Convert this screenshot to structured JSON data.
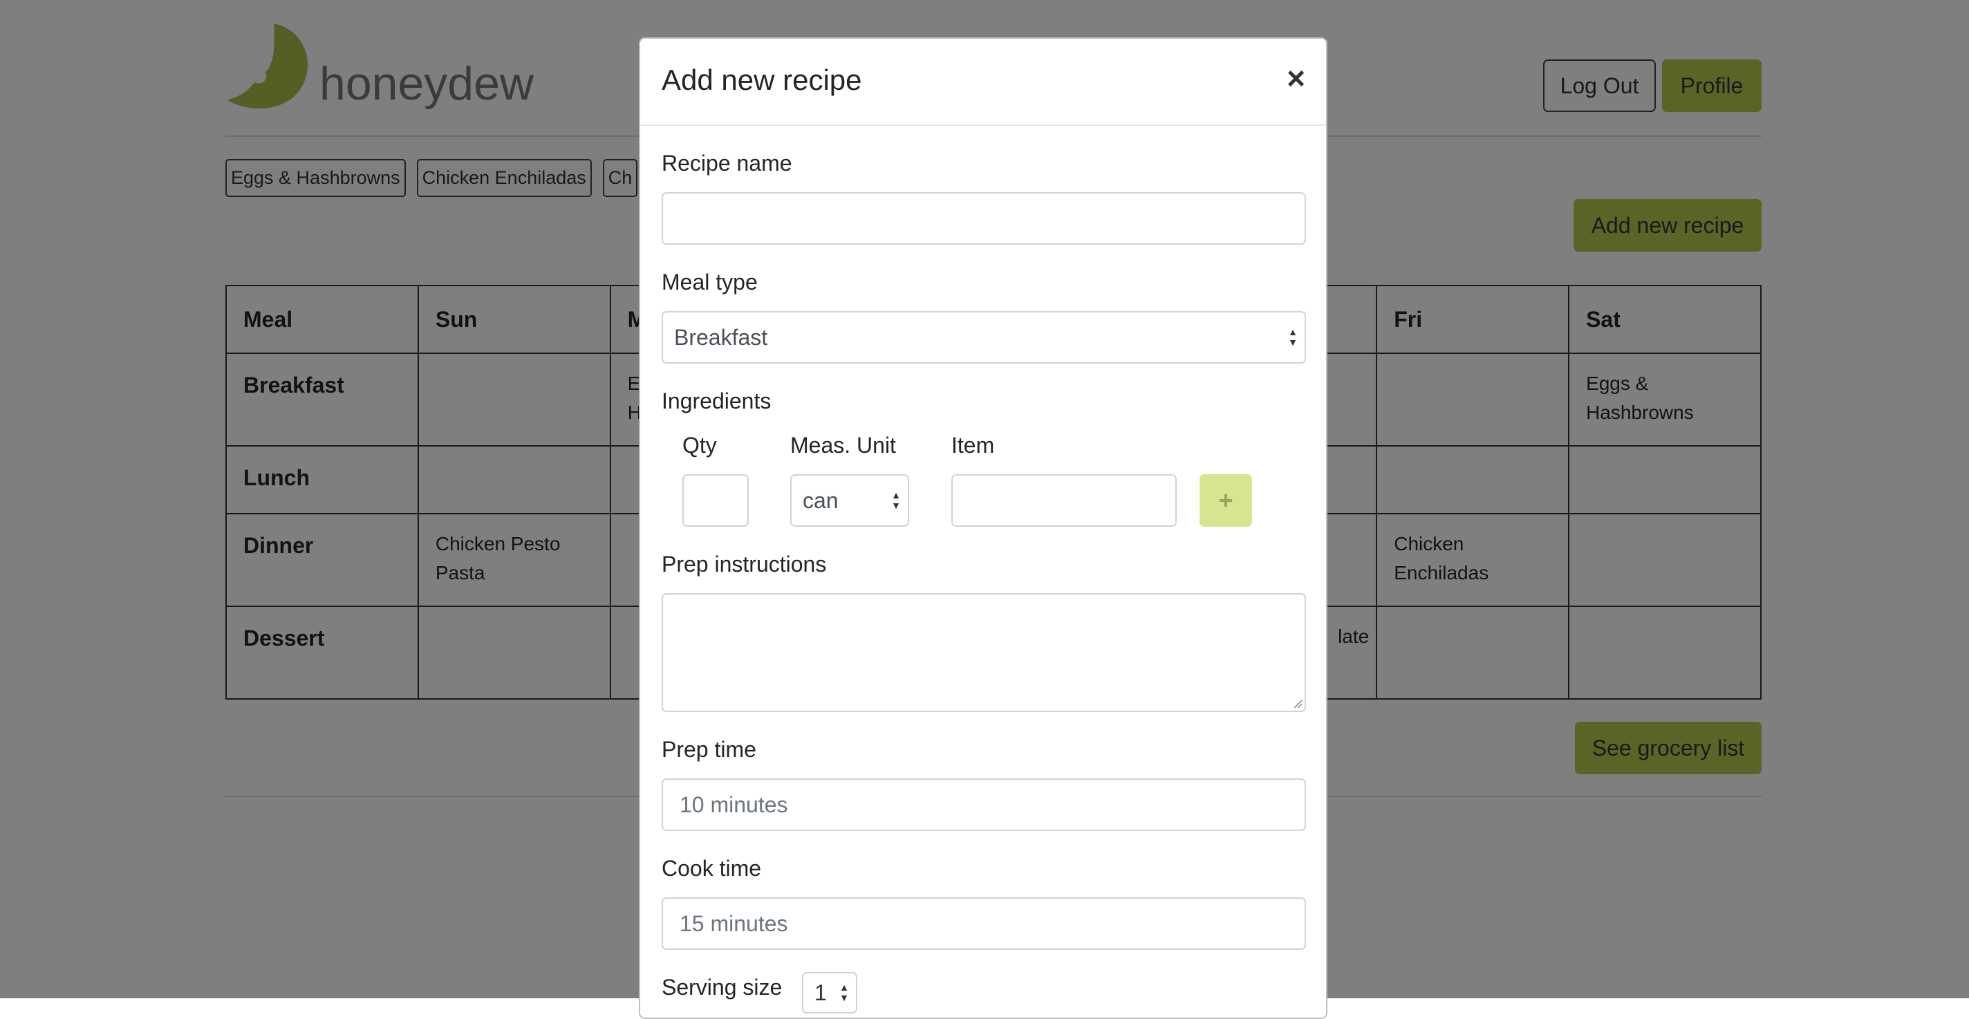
{
  "header": {
    "logo_text": "honeydew",
    "logout_label": "Log Out",
    "profile_label": "Profile"
  },
  "recipes": [
    "Eggs & Hashbrowns",
    "Chicken Enchiladas",
    "Ch"
  ],
  "add_recipe_label": "Add new recipe",
  "grocery_label": "See grocery list",
  "table": {
    "headers": [
      "Meal",
      "Sun",
      "M",
      "Fri",
      "Sat"
    ],
    "rows": [
      {
        "meal": "Breakfast",
        "sun": "",
        "mon": "E\nH",
        "fri": "",
        "sat": "Eggs &\nHashbrowns"
      },
      {
        "meal": "Lunch",
        "sun": "",
        "mon": "",
        "fri": "",
        "sat": ""
      },
      {
        "meal": "Dinner",
        "sun": "Chicken Pesto\nPasta",
        "mon": "",
        "fri": "Chicken\nEnchiladas",
        "sat": ""
      },
      {
        "meal": "Dessert",
        "sun": "",
        "mon": "",
        "thu": "late",
        "fri": "",
        "sat": ""
      }
    ]
  },
  "modal": {
    "title": "Add new recipe",
    "close": "×",
    "recipe_name_label": "Recipe name",
    "recipe_name_value": "",
    "meal_type_label": "Meal type",
    "meal_type_value": "Breakfast",
    "ingredients_label": "Ingredients",
    "qty_label": "Qty",
    "unit_label": "Meas. Unit",
    "item_label": "Item",
    "unit_value": "can",
    "plus_label": "+",
    "prep_instructions_label": "Prep instructions",
    "prep_time_label": "Prep time",
    "prep_time_placeholder": "10 minutes",
    "cook_time_label": "Cook time",
    "cook_time_placeholder": "15 minutes",
    "serving_size_label": "Serving size",
    "serving_size_value": "1"
  },
  "colors": {
    "accent": "#b5c94d",
    "accent_light": "#d7e490",
    "logo_green": "#a9bd4a"
  }
}
